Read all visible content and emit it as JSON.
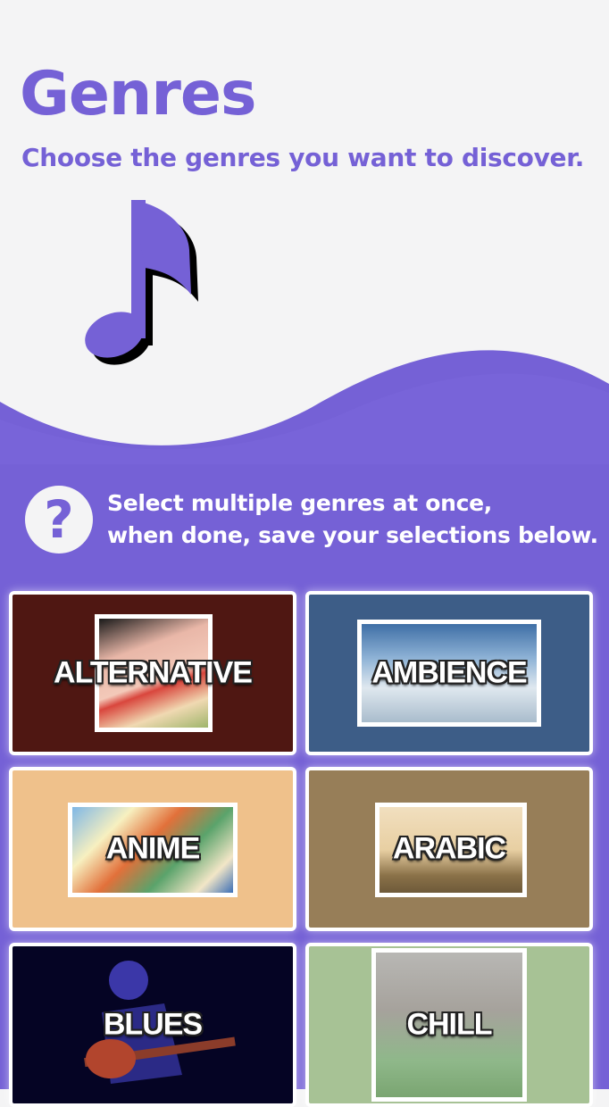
{
  "header": {
    "title": "Genres",
    "subtitle": "Choose the genres you want to discover."
  },
  "help": {
    "icon": "?",
    "line1": "Select multiple genres at once,",
    "line2": "when done, save your selections below."
  },
  "colors": {
    "accent": "#7561d6",
    "background": "#f4f4f5"
  },
  "genres": [
    {
      "label": "ALTERNATIVE",
      "bg": "#4f1712"
    },
    {
      "label": "AMBIENCE",
      "bg": "#3d5d87"
    },
    {
      "label": "ANIME",
      "bg": "#efc18b"
    },
    {
      "label": "ARABIC",
      "bg": "#977e58"
    },
    {
      "label": "BLUES",
      "bg": "#050424"
    },
    {
      "label": "CHILL",
      "bg": "#a7c295"
    }
  ]
}
